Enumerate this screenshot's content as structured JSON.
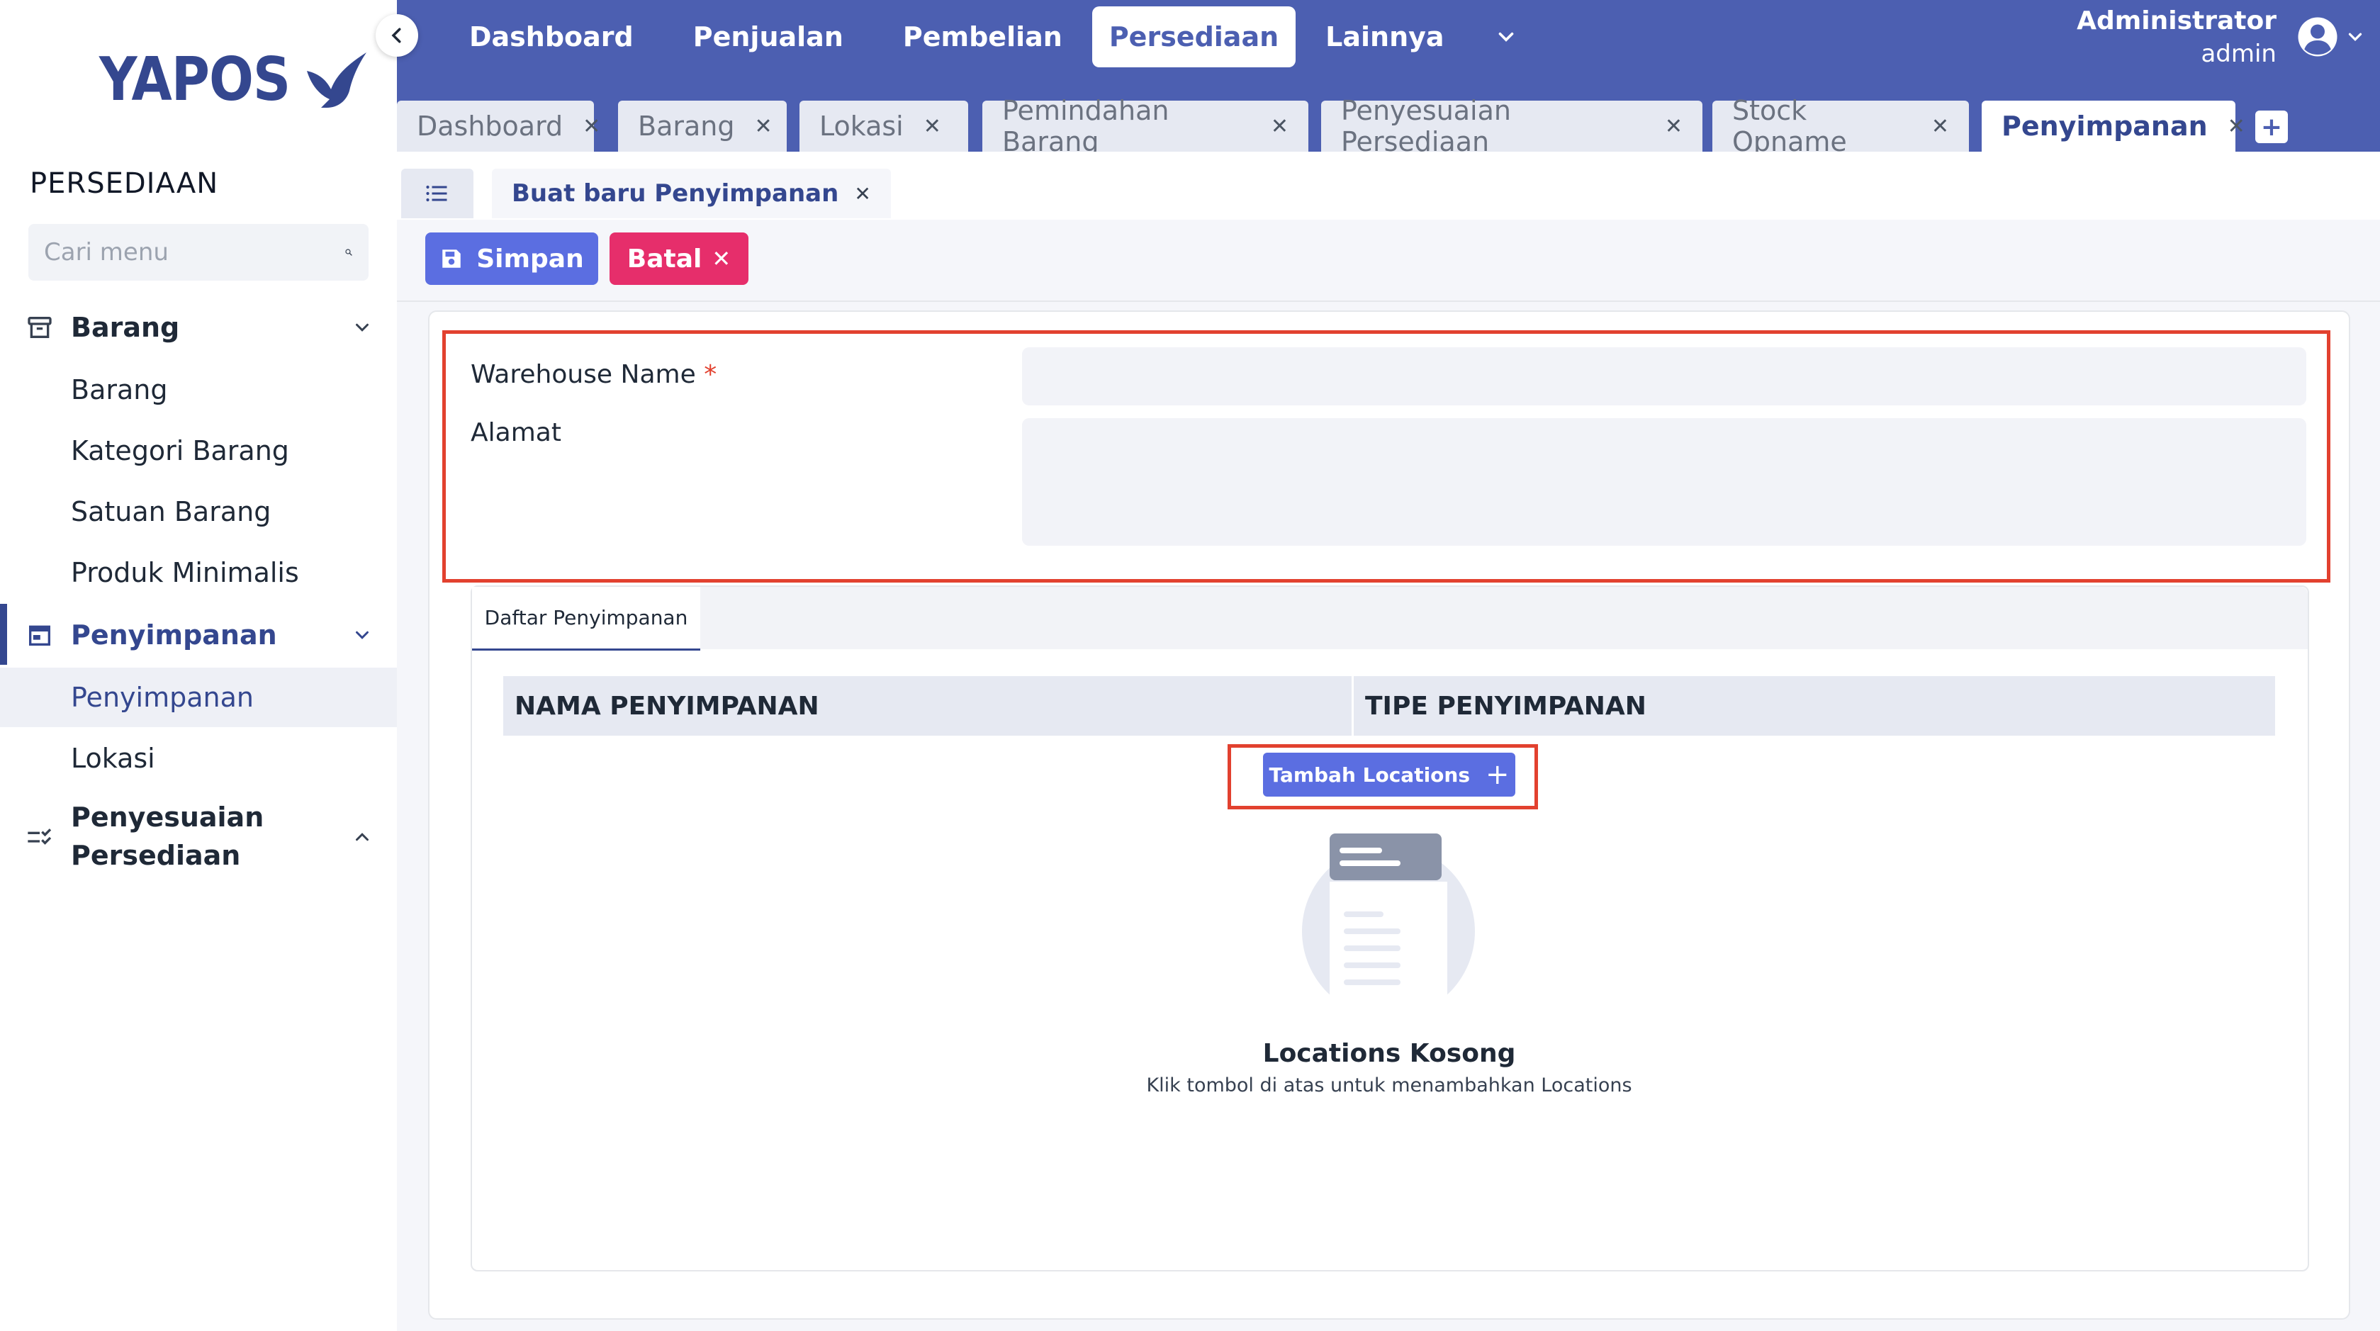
{
  "app": {
    "logo_text": "YAPOS"
  },
  "sidebar": {
    "section_title": "PERSEDIAAN",
    "search_placeholder": "Cari menu",
    "groups": [
      {
        "label": "Barang",
        "icon": "archive-icon",
        "expanded": true,
        "items": [
          "Barang",
          "Kategori Barang",
          "Satuan Barang",
          "Produk Minimalis"
        ]
      },
      {
        "label": "Penyimpanan",
        "icon": "store-icon",
        "expanded": true,
        "active": true,
        "items": [
          "Penyimpanan",
          "Lokasi"
        ],
        "selected_item": "Penyimpanan"
      },
      {
        "label_line1": "Penyesuaian",
        "label_line2": "Persediaan",
        "icon": "checklist-icon",
        "expanded": false
      }
    ]
  },
  "topbar": {
    "menu": [
      "Dashboard",
      "Penjualan",
      "Pembelian",
      "Persediaan",
      "Lainnya"
    ],
    "active_menu": "Persediaan",
    "user_name": "Administrator",
    "user_role": "admin"
  },
  "tabs": [
    {
      "label": "Dashboard"
    },
    {
      "label": "Barang"
    },
    {
      "label": "Lokasi"
    },
    {
      "label": "Pemindahan Barang"
    },
    {
      "label": "Penyesuaian Persediaan"
    },
    {
      "label": "Stock Opname"
    },
    {
      "label": "Penyimpanan",
      "active": true
    }
  ],
  "subtab": {
    "label": "Buat baru Penyimpanan"
  },
  "actions": {
    "save_label": "Simpan",
    "cancel_label": "Batal"
  },
  "form": {
    "warehouse_label": "Warehouse Name",
    "required_mark": "*",
    "warehouse_value": "",
    "address_label": "Alamat",
    "address_value": ""
  },
  "locations": {
    "tab_label": "Daftar Penyimpanan",
    "columns": [
      "NAMA PENYIMPANAN",
      "TIPE PENYIMPANAN"
    ],
    "add_label": "Tambah Locations",
    "empty_title": "Locations Kosong",
    "empty_subtitle": "Klik tombol di atas untuk menambahkan Locations"
  },
  "colors": {
    "primary": "#4c5fb1",
    "brand_dark": "#34478f",
    "button_blue": "#5b6ee1",
    "danger": "#e62e6b",
    "highlight": "#e2412f"
  }
}
